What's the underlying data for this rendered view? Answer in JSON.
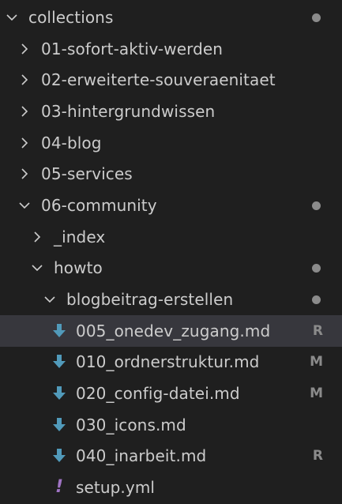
{
  "explorer": {
    "root": {
      "label": "collections",
      "expanded": true,
      "modified_dot": true
    },
    "items": [
      {
        "label": "01-sofort-aktiv-werden",
        "kind": "folder",
        "expanded": false
      },
      {
        "label": "02-erweiterte-souveraenitaet",
        "kind": "folder",
        "expanded": false
      },
      {
        "label": "03-hintergrundwissen",
        "kind": "folder",
        "expanded": false
      },
      {
        "label": "04-blog",
        "kind": "folder",
        "expanded": false
      },
      {
        "label": "05-services",
        "kind": "folder",
        "expanded": false
      },
      {
        "label": "06-community",
        "kind": "folder",
        "expanded": true,
        "modified_dot": true
      },
      {
        "label": "_index",
        "kind": "folder",
        "expanded": false
      },
      {
        "label": "howto",
        "kind": "folder",
        "expanded": true,
        "modified_dot": true
      },
      {
        "label": "blogbeitrag-erstellen",
        "kind": "folder",
        "expanded": true,
        "modified_dot": true
      },
      {
        "label": "005_onedev_zugang.md",
        "kind": "markdown",
        "status": "R",
        "selected": true,
        "icon": "markdown-download-icon"
      },
      {
        "label": "010_ordnerstruktur.md",
        "kind": "markdown",
        "status": "M",
        "icon": "markdown-download-icon"
      },
      {
        "label": "020_config-datei.md",
        "kind": "markdown",
        "status": "M",
        "icon": "markdown-download-icon"
      },
      {
        "label": "030_icons.md",
        "kind": "markdown",
        "status": "",
        "icon": "markdown-download-icon"
      },
      {
        "label": "040_inarbeit.md",
        "kind": "markdown",
        "status": "R",
        "icon": "markdown-download-icon"
      },
      {
        "label": "setup.yml",
        "kind": "yaml",
        "status": "",
        "icon": "yaml-exclamation-icon",
        "icon_glyph": "!"
      }
    ]
  },
  "colors": {
    "background": "#1f1f1f",
    "selected_row": "#37373d",
    "text": "#cccccc",
    "muted": "#8b8b8b",
    "markdown_icon": "#519aba",
    "yaml_icon": "#a074c4"
  }
}
